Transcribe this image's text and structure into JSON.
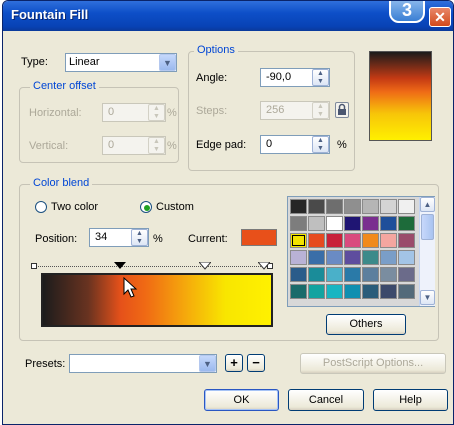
{
  "window": {
    "title": "Fountain Fill",
    "close_glyph": "✕",
    "badge": "3"
  },
  "type": {
    "label": "Type:",
    "value": "Linear"
  },
  "center_offset": {
    "legend": "Center offset",
    "horizontal_label": "Horizontal:",
    "horizontal_value": "0",
    "vertical_label": "Vertical:",
    "vertical_value": "0",
    "unit": "%"
  },
  "options": {
    "legend": "Options",
    "angle_label": "Angle:",
    "angle_value": "-90,0",
    "steps_label": "Steps:",
    "steps_value": "256",
    "edge_label": "Edge pad:",
    "edge_value": "0",
    "unit": "%"
  },
  "color_blend": {
    "legend": "Color blend",
    "two_color_label": "Two color",
    "custom_label": "Custom",
    "selected_mode": "custom",
    "position_label": "Position:",
    "position_value": "34",
    "position_unit": "%",
    "current_label": "Current:",
    "current_color": "#e8501a",
    "others_label": "Others"
  },
  "presets": {
    "label": "Presets:",
    "value": "",
    "postscript_label": "PostScript Options..."
  },
  "buttons": {
    "ok": "OK",
    "cancel": "Cancel",
    "help": "Help"
  },
  "icons": {
    "close": "close-icon",
    "combo": "chevron-down-icon",
    "spin": "spinner-arrows-icon",
    "lock": "lock-icon",
    "add": "plus-icon",
    "remove": "minus-icon",
    "cursor": "mouse-pointer-icon",
    "marker": "color-stop-marker-icon"
  },
  "palette": [
    [
      "#262626",
      "#4a4a4a",
      "#6e6e6e",
      "#8f8f8f",
      "#b5b5b5",
      "#d4d4d4",
      "#f0f0f0"
    ],
    [
      "#7d7d7d",
      "#bfbfbf",
      "#ffffff",
      "#1f1573",
      "#7a2e8f",
      "#1e4f9a",
      "#1d6b3a"
    ],
    [
      "#f2e300",
      "#e64a1f",
      "#c8213a",
      "#d94a7e",
      "#f08a1c",
      "#f4a6a0",
      "#9a4b6b"
    ],
    [
      "#b9b2d6",
      "#3a6ea8",
      "#6a8bc4",
      "#5e4d9e",
      "#3c8a8a",
      "#7a9ec8",
      "#a3c4e6"
    ],
    [
      "#2a5c8a",
      "#1a8c99",
      "#4ab0c9",
      "#2a7aa8",
      "#5c7f9e",
      "#7a8da0",
      "#6b6b8a"
    ],
    [
      "#1a6b6b",
      "#13a3a0",
      "#18b5c2",
      "#0f8fb0",
      "#2a5c7a",
      "#3c4a6b",
      "#536a7a"
    ]
  ],
  "palette_selected": [
    2,
    0
  ]
}
